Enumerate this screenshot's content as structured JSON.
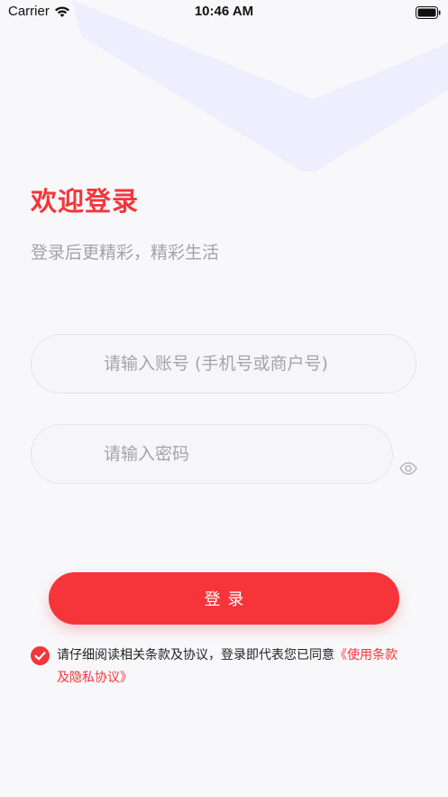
{
  "status_bar": {
    "carrier": "Carrier",
    "time": "10:46 AM"
  },
  "header": {
    "title": "欢迎登录",
    "subtitle": "登录后更精彩，精彩生活"
  },
  "form": {
    "account_placeholder": "请输入账号 (手机号或商户号)",
    "account_value": "",
    "password_placeholder": "请输入密码",
    "password_value": "",
    "login_label": "登录"
  },
  "agreement": {
    "checked": true,
    "text": "请仔细阅读相关条款及协议，登录即代表您已同意",
    "link": "《使用条款及隐私协议》"
  },
  "colors": {
    "accent": "#f5353a",
    "chevron": "#eeeeff",
    "background": "#f8f8fa"
  },
  "icons": [
    "wifi-icon",
    "battery-icon",
    "eye-icon",
    "checkmark-icon"
  ]
}
